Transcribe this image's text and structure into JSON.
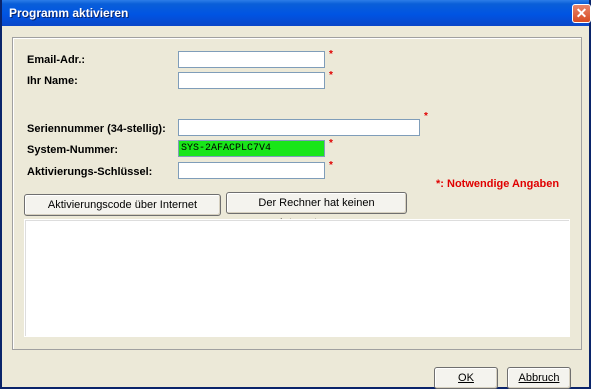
{
  "window": {
    "title": "Programm aktivieren",
    "close_glyph": "✕"
  },
  "form": {
    "email_label": "Email-Adr.:",
    "name_label": "Ihr Name:",
    "serial_label": "Seriennummer (34-stellig):",
    "system_label": "System-Nummer:",
    "system_value": "SYS-2AFACPLC7V4",
    "activation_label": "Aktivierungs-Schlüssel:",
    "required_marker": "*",
    "required_note": "*: Notwendige Angaben"
  },
  "buttons": {
    "internet_query": "Aktivierungscode über Internet abfragen",
    "no_internet": "Der Rechner hat keinen Internetzugang",
    "ok": "OK",
    "cancel": "Abbruch"
  },
  "colors": {
    "system_field_bg": "#19e619",
    "required": "#e00000",
    "titlebar": "#0054e3"
  }
}
